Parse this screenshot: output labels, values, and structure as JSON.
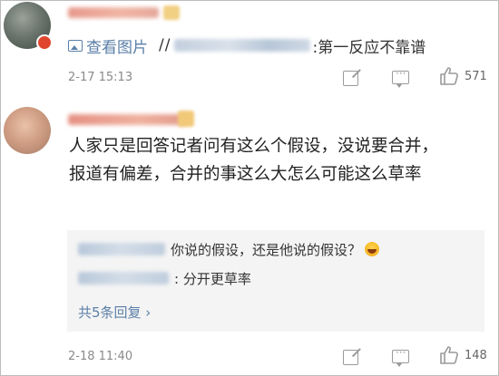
{
  "comment1": {
    "image_link": "查看图片",
    "slashes": "//",
    "quote_text": ":第一反应不靠谱",
    "time": "2-17 15:13",
    "likes": "571"
  },
  "comment2": {
    "body": "人家只是回答记者问有这么个假设，没说要合并，报道有偏差，合并的事这么大怎么可能这么草率",
    "replies": [
      {
        "text": "你说的假设，还是他说的假设？"
      },
      {
        "text": ": 分开更草率"
      }
    ],
    "more_replies": "共5条回复 ›",
    "time": "2-18 11:40",
    "likes": "148"
  },
  "icons": {
    "share": "share-icon",
    "comment": "comment-icon",
    "like": "thumbs-up-icon",
    "picture": "picture-icon",
    "emoji": "laughing-emoji-icon"
  },
  "colors": {
    "link": "#5b7fa8",
    "meta": "#8a8a8a",
    "reply_bg": "#f4f4f4"
  }
}
